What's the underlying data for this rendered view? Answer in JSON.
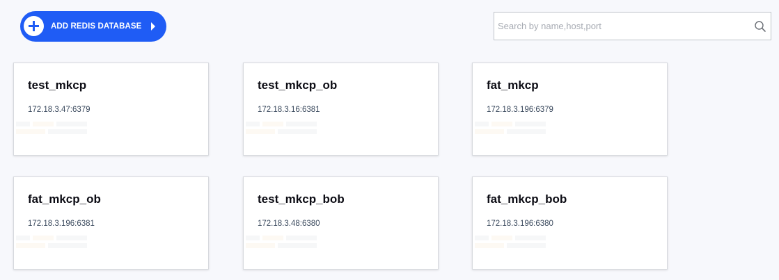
{
  "toolbar": {
    "add_button_label": "ADD REDIS DATABASE"
  },
  "search": {
    "placeholder": "Search by name,host,port",
    "value": ""
  },
  "databases": [
    {
      "name": "test_mkcp",
      "address": "172.18.3.47:6379"
    },
    {
      "name": "test_mkcp_ob",
      "address": "172.18.3.16:6381"
    },
    {
      "name": "fat_mkcp",
      "address": "172.18.3.196:6379"
    },
    {
      "name": "fat_mkcp_ob",
      "address": "172.18.3.196:6381"
    },
    {
      "name": "test_mkcp_bob",
      "address": "172.18.3.48:6380"
    },
    {
      "name": "fat_mkcp_bob",
      "address": "172.18.3.196:6380"
    }
  ],
  "colors": {
    "accent": "#1f5cf5",
    "background": "#f7f8fc",
    "card_title": "#0c0c14",
    "card_address": "#3b4a5e"
  }
}
